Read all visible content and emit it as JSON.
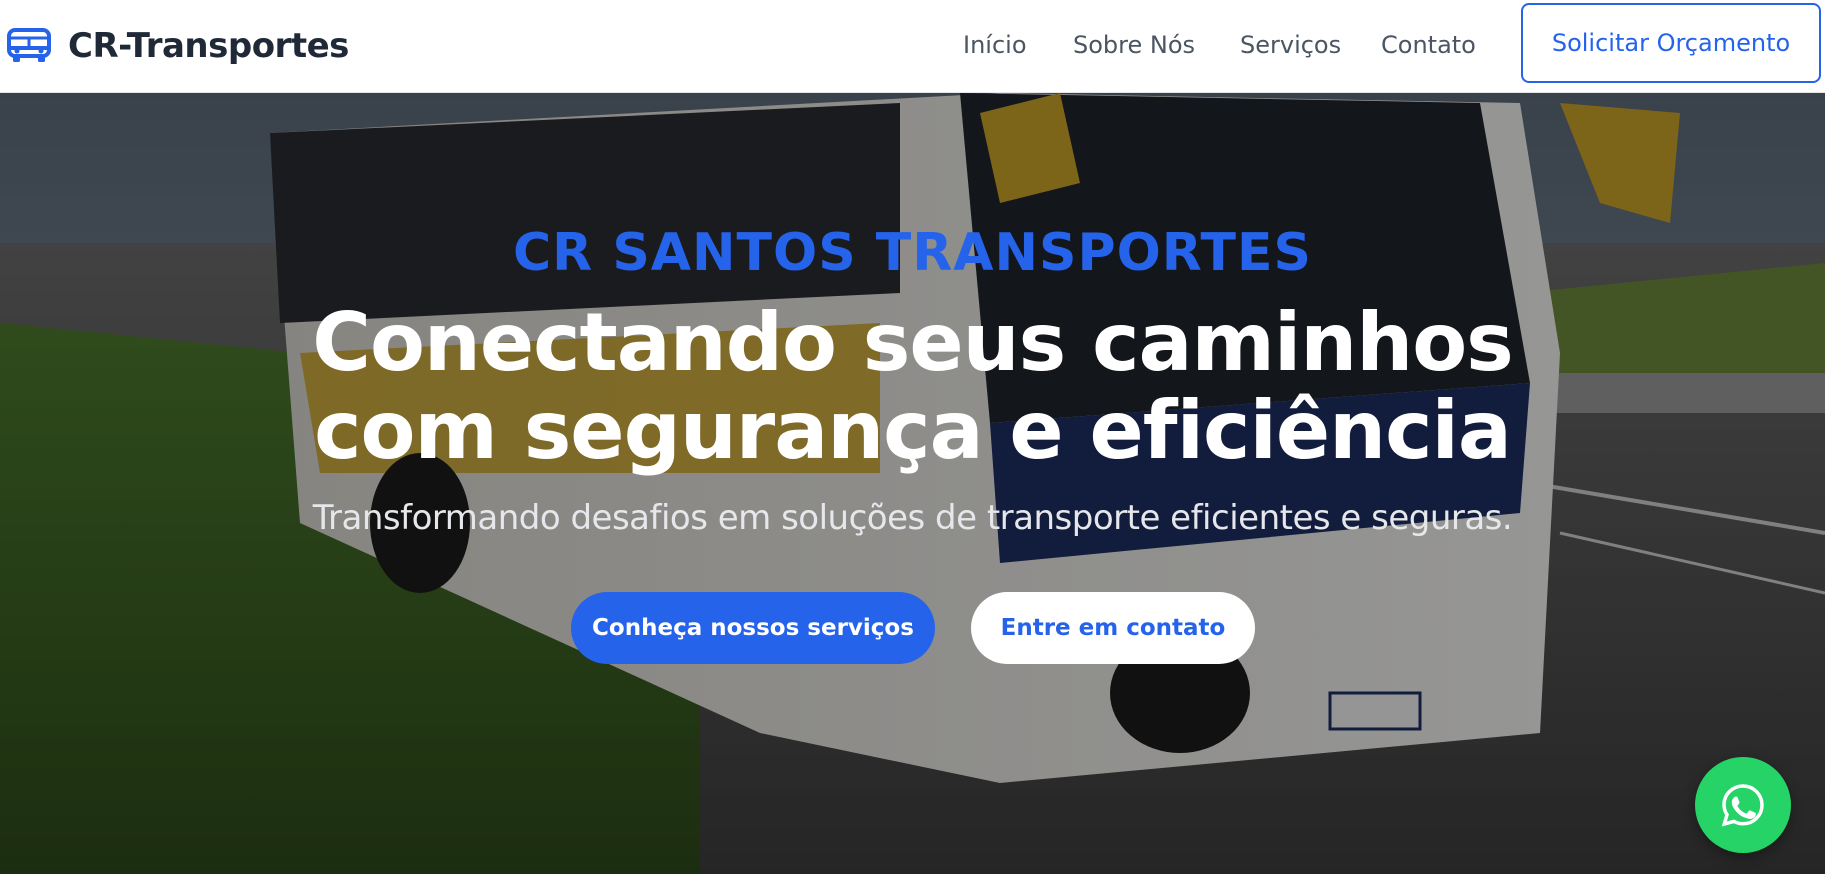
{
  "brand": {
    "name": "CR-Transportes",
    "icon": "bus-icon",
    "accent": "#2563eb"
  },
  "nav": {
    "links": [
      "Início",
      "Sobre Nós",
      "Serviços",
      "Contato"
    ],
    "cta_label": "Solicitar Orçamento"
  },
  "hero": {
    "kicker": "CR SANTOS TRANSPORTES",
    "headline_line1": "Conectando seus caminhos",
    "headline_line2": "com segurança e eficiência",
    "subtitle": "Transformando desafios em soluções de transporte eficientes e seguras.",
    "primary_button": "Conheça nossos serviços",
    "secondary_button": "Entre em contato",
    "background_image": "bus-photo"
  },
  "floating": {
    "icon": "whatsapp-icon",
    "color": "#25d366"
  }
}
